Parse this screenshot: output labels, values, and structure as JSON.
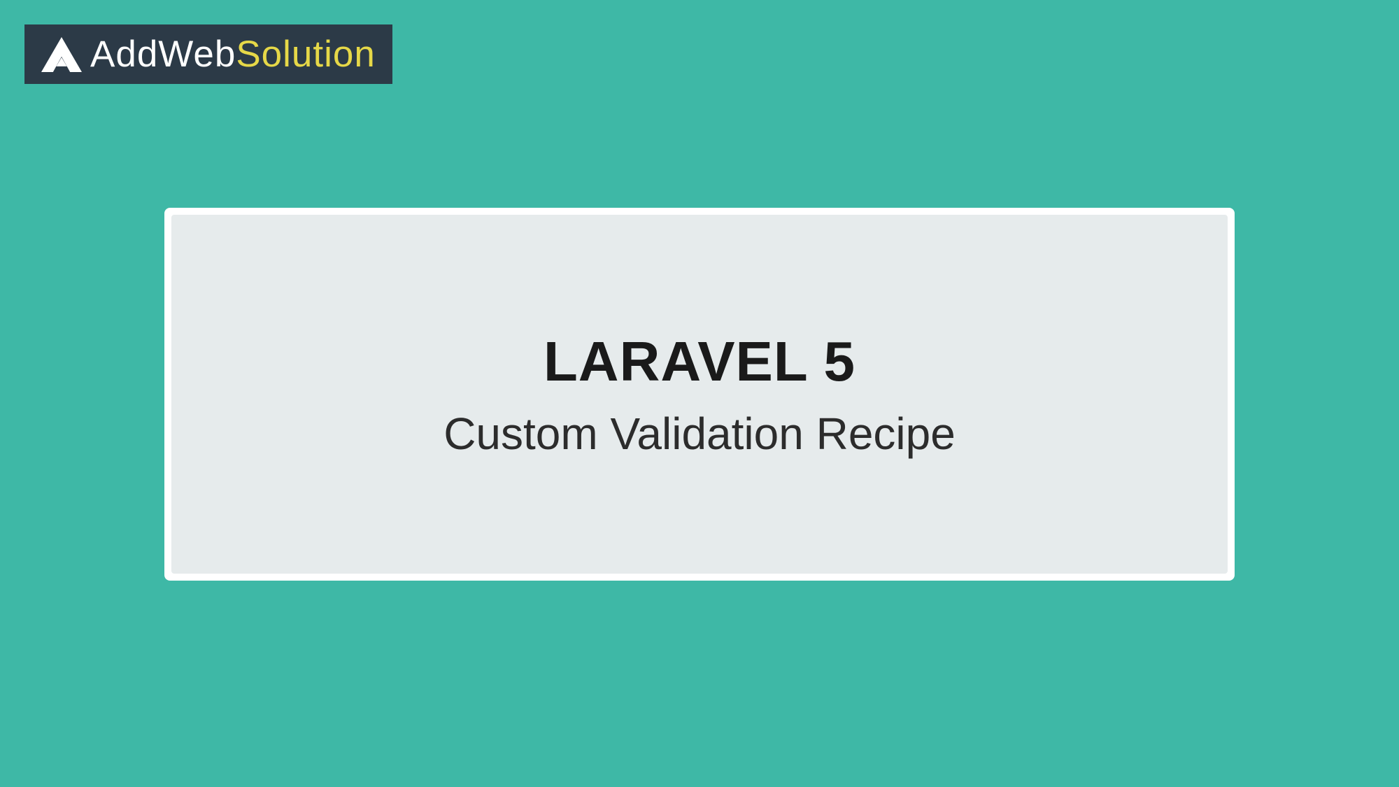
{
  "logo": {
    "text_part1": "AddWeb",
    "text_part2": "Solution",
    "icon_name": "triangle-a-icon"
  },
  "card": {
    "heading": "LARAVEL 5",
    "subheading": "Custom Validation Recipe"
  },
  "colors": {
    "background": "#3eb8a6",
    "logo_bg": "#2c3a47",
    "logo_accent": "#e6d848",
    "card_bg": "#ffffff",
    "card_inner_bg": "#e6ebec"
  }
}
